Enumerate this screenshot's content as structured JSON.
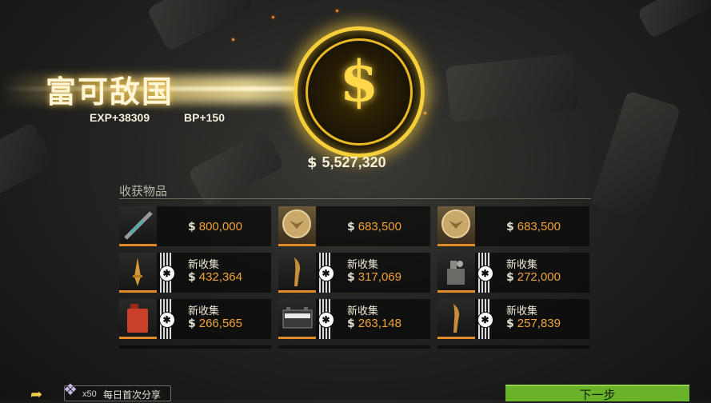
{
  "result": {
    "title": "富可敌国",
    "exp": "EXP+38309",
    "bp": "BP+150",
    "total_currency_icon": "coin-icon",
    "total": "5,527,320"
  },
  "items_section": {
    "label": "收获物品",
    "new_label": "新收集",
    "items": [
      {
        "name": "rifle-item-icon",
        "value": "800,000",
        "new": false
      },
      {
        "name": "eagle-coin-item-icon",
        "value": "683,500",
        "new": false
      },
      {
        "name": "eagle-coin-item-icon",
        "value": "683,500",
        "new": false
      },
      {
        "name": "golden-dagger-item-icon",
        "value": "432,364",
        "new": true
      },
      {
        "name": "golden-horn-item-icon",
        "value": "317,069",
        "new": true
      },
      {
        "name": "device-item-icon",
        "value": "272,000",
        "new": true
      },
      {
        "name": "fuel-can-item-icon",
        "value": "266,565",
        "new": true
      },
      {
        "name": "battery-item-icon",
        "value": "263,148",
        "new": true
      },
      {
        "name": "golden-horn-item-icon",
        "value": "257,839",
        "new": true
      }
    ]
  },
  "footer": {
    "share_icon": "share-icon",
    "gem_icon": "gem-icon",
    "reward": "x50",
    "share_label": "每日首次分享",
    "next_label": "下一步"
  },
  "colors": {
    "accent_gold": "#f5cf3a",
    "value_orange": "#f0a23a",
    "next_green": "#6ab22a"
  }
}
